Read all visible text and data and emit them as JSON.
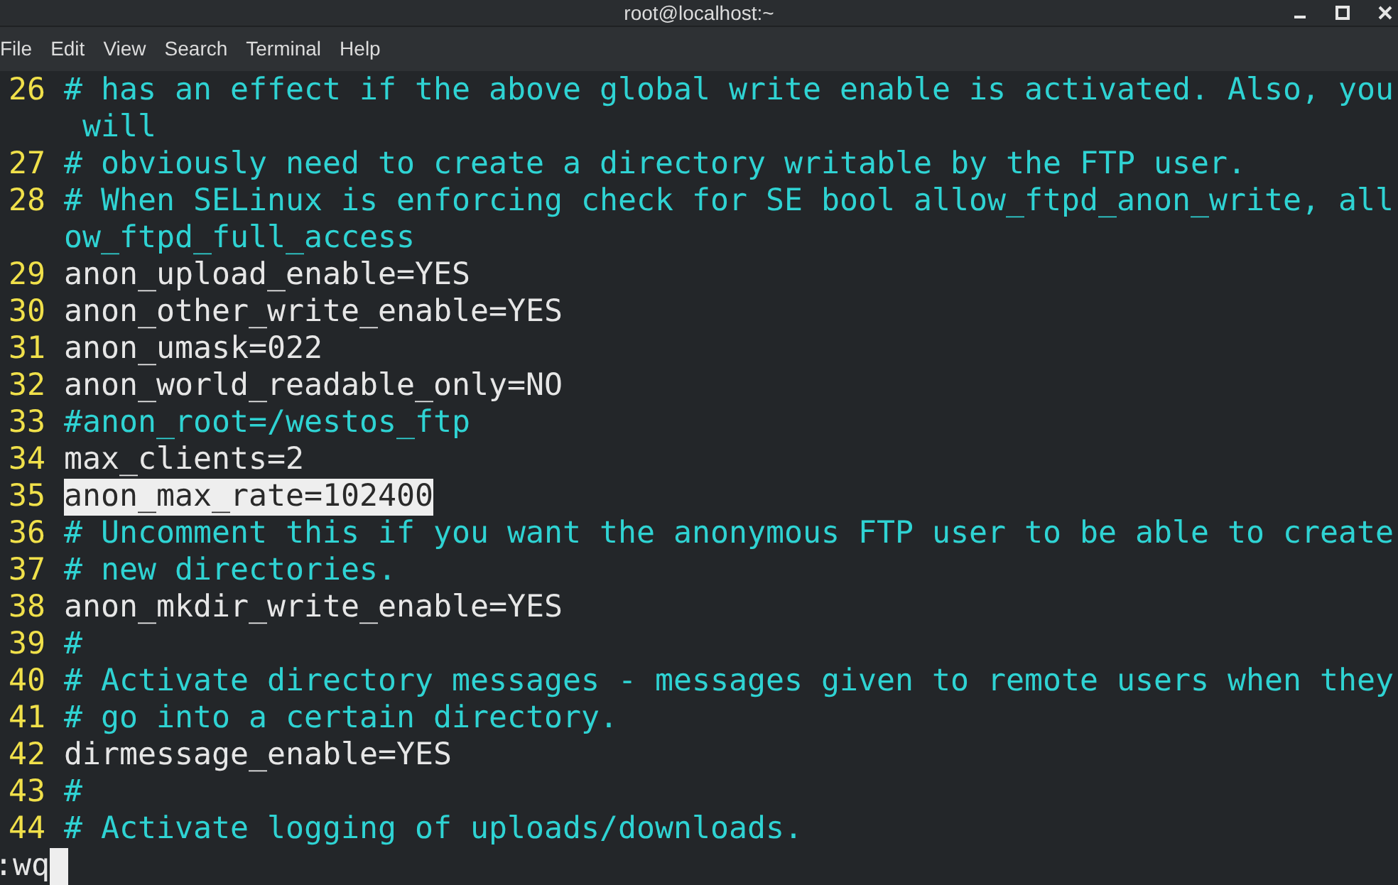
{
  "window": {
    "title": "root@localhost:~"
  },
  "menu": [
    {
      "label": "File"
    },
    {
      "label": "Edit"
    },
    {
      "label": "View"
    },
    {
      "label": "Search"
    },
    {
      "label": "Terminal"
    },
    {
      "label": "Help"
    }
  ],
  "lines": [
    {
      "number": "26",
      "kind": "comment",
      "highlighted": false,
      "rows": [
        "# has an effect if the above global write enable is activated. Also, you",
        " will"
      ]
    },
    {
      "number": "27",
      "kind": "comment",
      "highlighted": false,
      "rows": [
        "# obviously need to create a directory writable by the FTP user."
      ]
    },
    {
      "number": "28",
      "kind": "comment",
      "highlighted": false,
      "rows": [
        "# When SELinux is enforcing check for SE bool allow_ftpd_anon_write, all",
        "ow_ftpd_full_access"
      ]
    },
    {
      "number": "29",
      "kind": "setting",
      "highlighted": false,
      "rows": [
        "anon_upload_enable=YES"
      ]
    },
    {
      "number": "30",
      "kind": "setting",
      "highlighted": false,
      "rows": [
        "anon_other_write_enable=YES"
      ]
    },
    {
      "number": "31",
      "kind": "setting",
      "highlighted": false,
      "rows": [
        "anon_umask=022"
      ]
    },
    {
      "number": "32",
      "kind": "setting",
      "highlighted": false,
      "rows": [
        "anon_world_readable_only=NO"
      ]
    },
    {
      "number": "33",
      "kind": "comment",
      "highlighted": false,
      "rows": [
        "#anon_root=/westos_ftp"
      ]
    },
    {
      "number": "34",
      "kind": "setting",
      "highlighted": false,
      "rows": [
        "max_clients=2"
      ]
    },
    {
      "number": "35",
      "kind": "setting",
      "highlighted": true,
      "rows": [
        "anon_max_rate=102400"
      ]
    },
    {
      "number": "36",
      "kind": "comment",
      "highlighted": false,
      "rows": [
        "# Uncomment this if you want the anonymous FTP user to be able to create"
      ]
    },
    {
      "number": "37",
      "kind": "comment",
      "highlighted": false,
      "rows": [
        "# new directories."
      ]
    },
    {
      "number": "38",
      "kind": "setting",
      "highlighted": false,
      "rows": [
        "anon_mkdir_write_enable=YES"
      ]
    },
    {
      "number": "39",
      "kind": "comment",
      "highlighted": false,
      "rows": [
        "#"
      ]
    },
    {
      "number": "40",
      "kind": "comment",
      "highlighted": false,
      "rows": [
        "# Activate directory messages - messages given to remote users when they"
      ]
    },
    {
      "number": "41",
      "kind": "comment",
      "highlighted": false,
      "rows": [
        "# go into a certain directory."
      ]
    },
    {
      "number": "42",
      "kind": "setting",
      "highlighted": false,
      "rows": [
        "dirmessage_enable=YES"
      ]
    },
    {
      "number": "43",
      "kind": "comment",
      "highlighted": false,
      "rows": [
        "#"
      ]
    },
    {
      "number": "44",
      "kind": "comment",
      "highlighted": false,
      "rows": [
        "# Activate logging of uploads/downloads."
      ]
    }
  ],
  "command_line": {
    "value": ":wq"
  }
}
